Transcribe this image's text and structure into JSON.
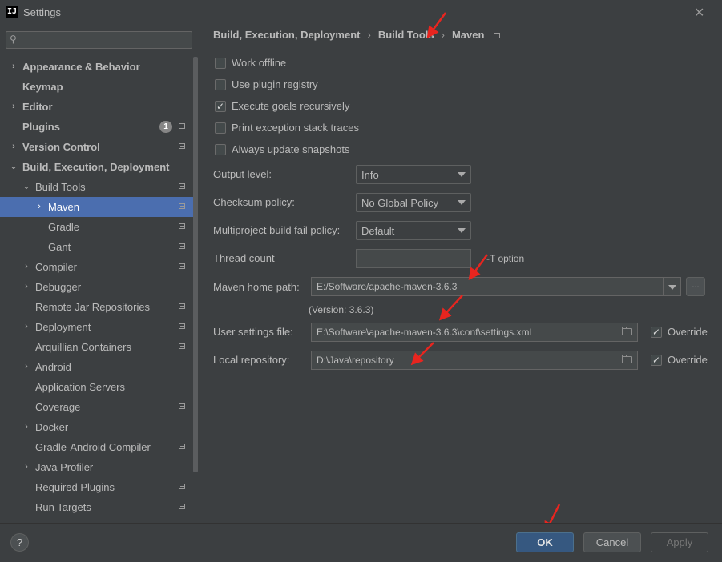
{
  "window": {
    "title": "Settings",
    "app_icon_text": "IJ",
    "close_glyph": "✕"
  },
  "search": {
    "placeholder": "",
    "value": "",
    "icon": "search-icon"
  },
  "tree": {
    "items": [
      {
        "label": "Appearance & Behavior",
        "bold": true,
        "arrow": "›",
        "level": 0
      },
      {
        "label": "Keymap",
        "bold": true,
        "arrow": "",
        "level": 0
      },
      {
        "label": "Editor",
        "bold": true,
        "arrow": "›",
        "level": 0
      },
      {
        "label": "Plugins",
        "bold": true,
        "arrow": "",
        "level": 0,
        "badge": "1",
        "page_icon": true
      },
      {
        "label": "Version Control",
        "bold": true,
        "arrow": "›",
        "level": 0,
        "page_icon": true
      },
      {
        "label": "Build, Execution, Deployment",
        "bold": true,
        "arrow": "⌄",
        "level": 0
      },
      {
        "label": "Build Tools",
        "bold": false,
        "arrow": "⌄",
        "level": 1,
        "page_icon": true
      },
      {
        "label": "Maven",
        "bold": false,
        "arrow": "›",
        "level": 2,
        "page_icon": true,
        "selected": true
      },
      {
        "label": "Gradle",
        "bold": false,
        "arrow": "",
        "level": 2,
        "page_icon": true
      },
      {
        "label": "Gant",
        "bold": false,
        "arrow": "",
        "level": 2,
        "page_icon": true
      },
      {
        "label": "Compiler",
        "bold": false,
        "arrow": "›",
        "level": 1,
        "page_icon": true
      },
      {
        "label": "Debugger",
        "bold": false,
        "arrow": "›",
        "level": 1
      },
      {
        "label": "Remote Jar Repositories",
        "bold": false,
        "arrow": "",
        "level": 1,
        "page_icon": true
      },
      {
        "label": "Deployment",
        "bold": false,
        "arrow": "›",
        "level": 1,
        "page_icon": true
      },
      {
        "label": "Arquillian Containers",
        "bold": false,
        "arrow": "",
        "level": 1,
        "page_icon": true
      },
      {
        "label": "Android",
        "bold": false,
        "arrow": "›",
        "level": 1
      },
      {
        "label": "Application Servers",
        "bold": false,
        "arrow": "",
        "level": 1
      },
      {
        "label": "Coverage",
        "bold": false,
        "arrow": "",
        "level": 1,
        "page_icon": true
      },
      {
        "label": "Docker",
        "bold": false,
        "arrow": "›",
        "level": 1
      },
      {
        "label": "Gradle-Android Compiler",
        "bold": false,
        "arrow": "",
        "level": 1,
        "page_icon": true
      },
      {
        "label": "Java Profiler",
        "bold": false,
        "arrow": "›",
        "level": 1
      },
      {
        "label": "Required Plugins",
        "bold": false,
        "arrow": "",
        "level": 1,
        "page_icon": true
      },
      {
        "label": "Run Targets",
        "bold": false,
        "arrow": "",
        "level": 1,
        "page_icon": true
      }
    ]
  },
  "breadcrumb": {
    "parts": [
      "Build, Execution, Deployment",
      "Build Tools",
      "Maven"
    ],
    "separator": "›"
  },
  "options": {
    "work_offline": {
      "label": "Work offline",
      "checked": false
    },
    "use_plugin_registry": {
      "label": "Use plugin registry",
      "checked": false
    },
    "execute_goals_recursively": {
      "label": "Execute goals recursively",
      "checked": true
    },
    "print_exception_stack_traces": {
      "label": "Print exception stack traces",
      "checked": false
    },
    "always_update_snapshots": {
      "label": "Always update snapshots",
      "checked": false
    }
  },
  "fields": {
    "output_level": {
      "label": "Output level:",
      "value": "Info"
    },
    "checksum_policy": {
      "label": "Checksum policy:",
      "value": "No Global Policy"
    },
    "multiproject_fail_policy": {
      "label": "Multiproject build fail policy:",
      "value": "Default"
    },
    "thread_count": {
      "label": "Thread count",
      "value": "",
      "suffix": "-T option"
    },
    "maven_home": {
      "label": "Maven home path:",
      "value": "E:/Software/apache-maven-3.6.3",
      "browse": "...",
      "version_note": "(Version: 3.6.3)"
    },
    "user_settings": {
      "label": "User settings file:",
      "value": "E:\\Software\\apache-maven-3.6.3\\conf\\settings.xml",
      "override_label": "Override",
      "override_checked": true
    },
    "local_repository": {
      "label": "Local repository:",
      "value": "D:\\Java\\repository",
      "override_label": "Override",
      "override_checked": true
    }
  },
  "footer": {
    "help": "?",
    "ok": "OK",
    "cancel": "Cancel",
    "apply": "Apply"
  },
  "colors": {
    "background": "#3c3f41",
    "selection": "#4b6eaf",
    "primary_button": "#365880",
    "annotation_arrows": "#e8251f"
  }
}
